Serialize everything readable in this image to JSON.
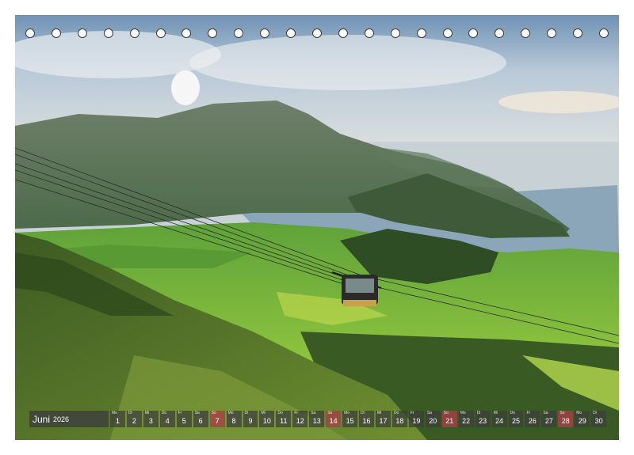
{
  "calendar": {
    "month": "Juni",
    "year": "2026",
    "days": [
      {
        "wd": "Mo",
        "d": "1"
      },
      {
        "wd": "Di",
        "d": "2"
      },
      {
        "wd": "Mi",
        "d": "3"
      },
      {
        "wd": "Do",
        "d": "4"
      },
      {
        "wd": "Fr",
        "d": "5"
      },
      {
        "wd": "Sa",
        "d": "6"
      },
      {
        "wd": "So",
        "d": "7"
      },
      {
        "wd": "Mo",
        "d": "8"
      },
      {
        "wd": "Di",
        "d": "9"
      },
      {
        "wd": "Mi",
        "d": "10"
      },
      {
        "wd": "Do",
        "d": "11"
      },
      {
        "wd": "Fr",
        "d": "12"
      },
      {
        "wd": "Sa",
        "d": "13"
      },
      {
        "wd": "So",
        "d": "14"
      },
      {
        "wd": "Mo",
        "d": "15"
      },
      {
        "wd": "Di",
        "d": "16"
      },
      {
        "wd": "Mi",
        "d": "17"
      },
      {
        "wd": "Do",
        "d": "18"
      },
      {
        "wd": "Fr",
        "d": "19"
      },
      {
        "wd": "Sa",
        "d": "20"
      },
      {
        "wd": "So",
        "d": "21"
      },
      {
        "wd": "Mo",
        "d": "22"
      },
      {
        "wd": "Di",
        "d": "23"
      },
      {
        "wd": "Mi",
        "d": "24"
      },
      {
        "wd": "Do",
        "d": "25"
      },
      {
        "wd": "Fr",
        "d": "26"
      },
      {
        "wd": "Sa",
        "d": "27"
      },
      {
        "wd": "So",
        "d": "28"
      },
      {
        "wd": "Mo",
        "d": "29"
      },
      {
        "wd": "Di",
        "d": "30"
      }
    ],
    "sundays": [
      "7",
      "14",
      "21",
      "28"
    ]
  },
  "binding": {
    "ring_count": 23
  },
  "colors": {
    "sky": "#c9d6e2",
    "meadow": "#7fb63a",
    "lake": "#8aa6b8",
    "sunday": "#aa3c46"
  }
}
